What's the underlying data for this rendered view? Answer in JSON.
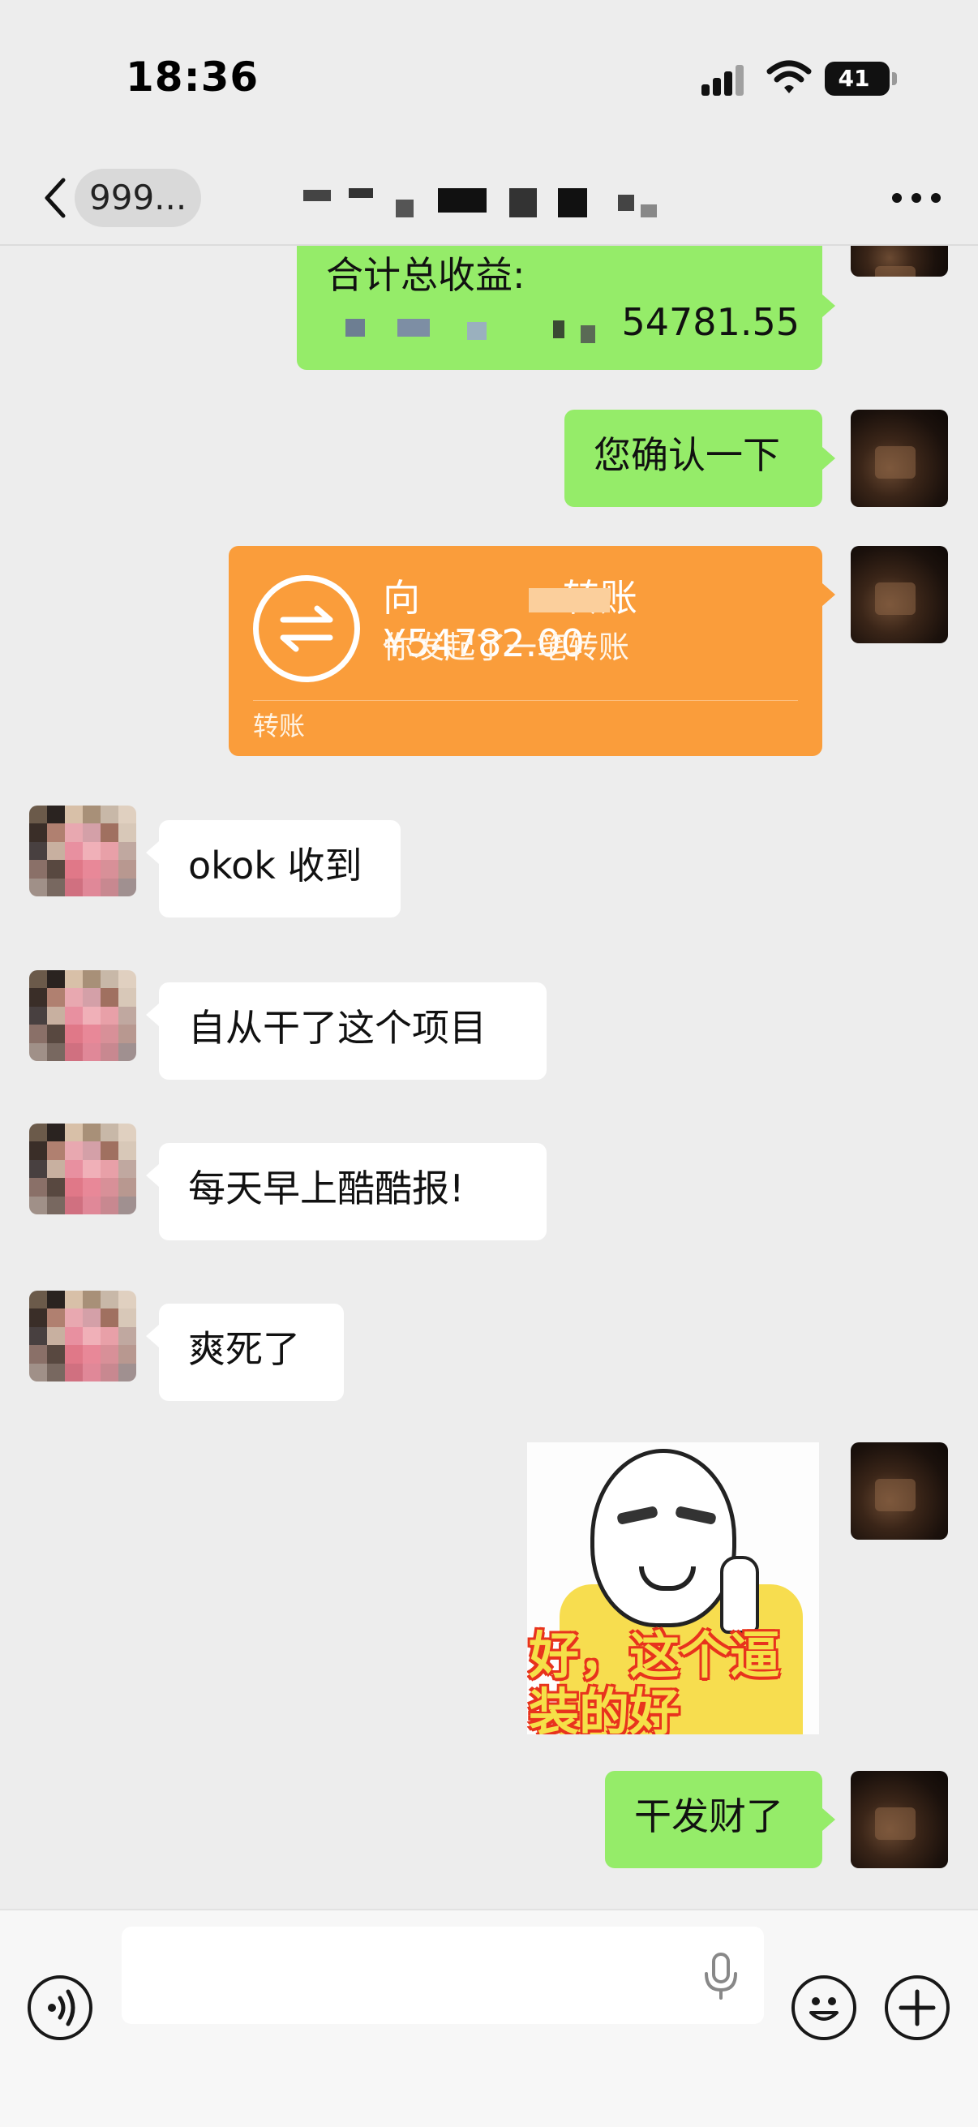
{
  "status_bar": {
    "time": "18:36",
    "battery": "41",
    "signal_icon": "signal-bars-icon",
    "wifi_icon": "wifi-icon"
  },
  "header": {
    "back_count": "999...",
    "title": "",
    "back_icon": "chevron-left-icon",
    "more_icon": "ellipsis-icon"
  },
  "messages": [
    {
      "side": "right",
      "type": "text",
      "label": "合计总收益:",
      "amount": "54781.55"
    },
    {
      "side": "right",
      "type": "text",
      "text": "您确认一下"
    },
    {
      "side": "right",
      "type": "transfer",
      "title_prefix": "向",
      "title_suffix": "转账¥54782.00",
      "subtitle": "你发起了一笔转账",
      "footer": "转账"
    },
    {
      "side": "left",
      "type": "text",
      "text": "okok 收到"
    },
    {
      "side": "left",
      "type": "text",
      "text": "自从干了这个项目"
    },
    {
      "side": "left",
      "type": "text",
      "text": "每天早上酷酷报!"
    },
    {
      "side": "left",
      "type": "text",
      "text": "爽死了"
    },
    {
      "side": "right",
      "type": "sticker",
      "caption": "好，这个逼\n装的好"
    },
    {
      "side": "right",
      "type": "text",
      "text": "干发财了"
    }
  ],
  "input_bar": {
    "text_value": "",
    "voice_icon": "voice-icon",
    "mic_icon": "microphone-icon",
    "emoji_icon": "emoji-icon",
    "plus_icon": "plus-icon"
  },
  "colors": {
    "background": "#ededed",
    "sent_bubble": "#95ec69",
    "received_bubble": "#ffffff",
    "transfer_card": "#fa9d3b"
  }
}
